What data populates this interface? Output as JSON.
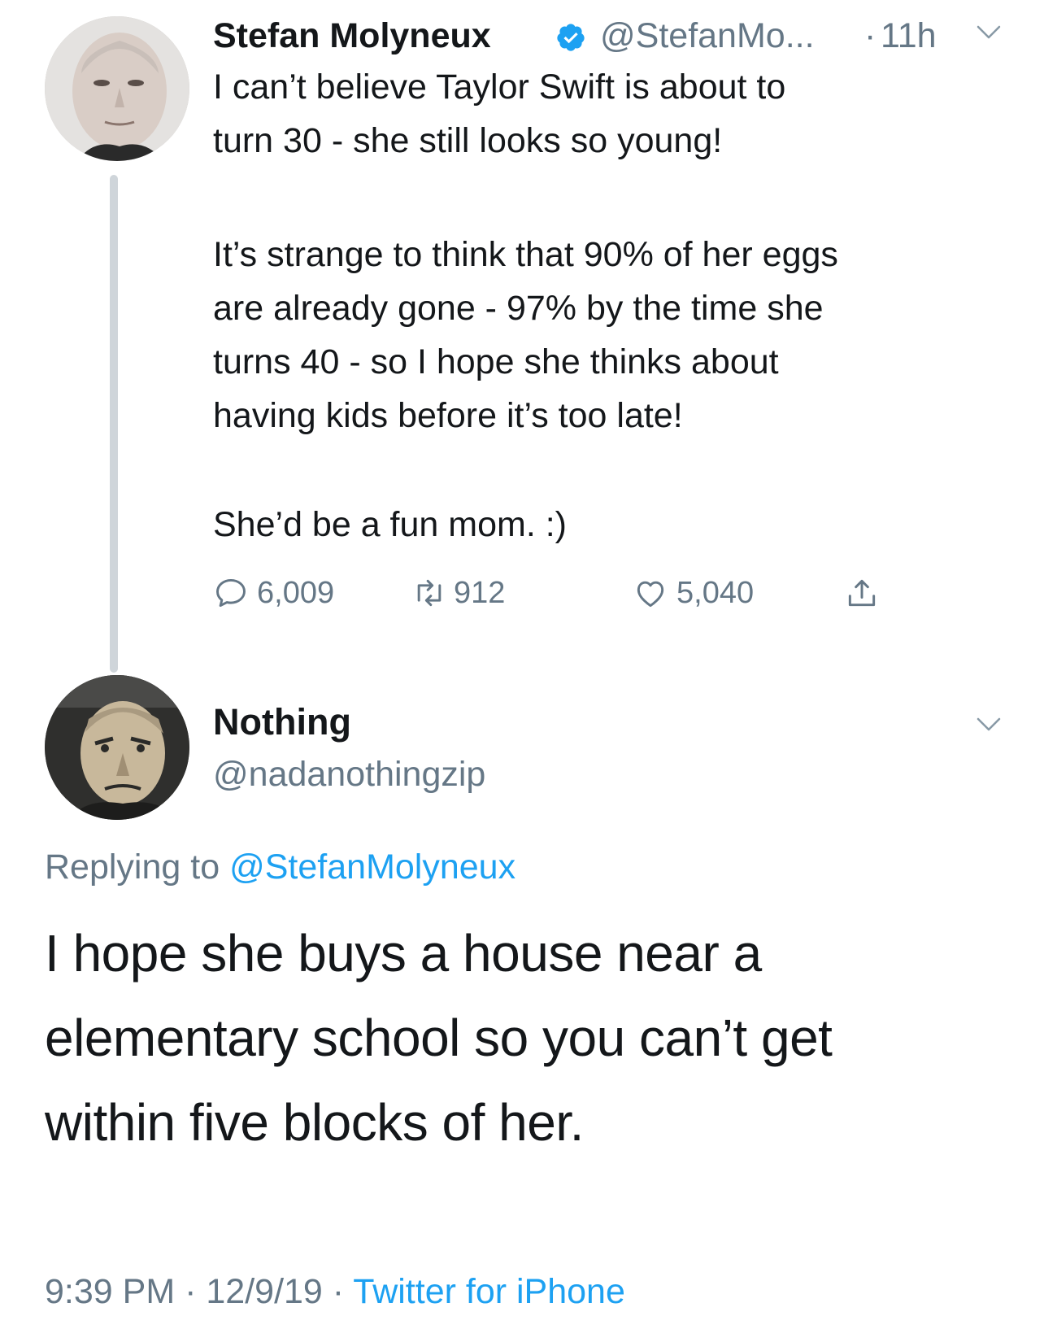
{
  "parent_tweet": {
    "display_name": "Stefan Molyneux",
    "handle": "@StefanMo...",
    "separator": "·",
    "time_ago": "11h",
    "text_lines": [
      "I can’t believe Taylor Swift is about to",
      "turn 30 - she still looks so young!",
      "It’s strange to think that 90% of her eggs",
      "are already gone - 97% by the time she",
      "turns 40 - so I hope she thinks about",
      "having kids before it’s too late!",
      "She’d be a fun mom. :)"
    ],
    "actions": {
      "replies": "6,009",
      "retweets": "912",
      "likes": "5,040"
    }
  },
  "reply_tweet": {
    "display_name": "Nothing",
    "handle": "@nadanothingzip",
    "replying_prefix": "Replying to",
    "replying_handle": "@StefanMolyneux",
    "text_lines": [
      "I hope she buys a house near a",
      "elementary school so you can’t get",
      "within five blocks of her."
    ],
    "time": "9:39 PM",
    "date": "12/9/19",
    "separator": "·",
    "source": "Twitter for iPhone"
  },
  "colors": {
    "text": "#14171a",
    "secondary": "#657786",
    "accent": "#1da1f2",
    "thread_line": "#cfd5da"
  },
  "icons": [
    "verified-badge-icon",
    "chevron-down-icon",
    "reply-icon",
    "retweet-icon",
    "like-icon",
    "share-icon"
  ]
}
